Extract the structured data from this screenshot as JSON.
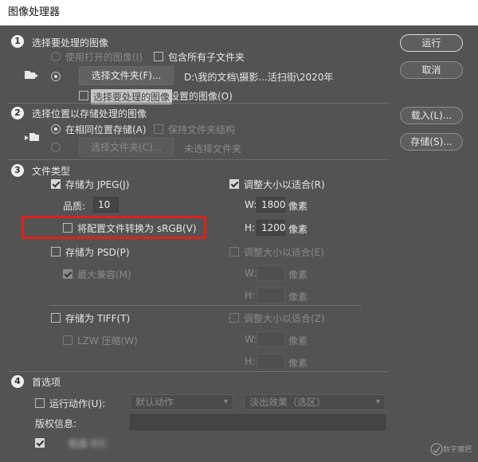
{
  "window": {
    "title": "图像处理器"
  },
  "section1": {
    "number": "1",
    "title": "选择要处理的图像",
    "use_open_label": "使用打开的图像(I)",
    "include_subfolders_label": "包含所有子文件夹",
    "select_folder_label": "选择文件夹(F)...",
    "folder_path": "D:\\我的文档\\摄影...活扫街\\2020年",
    "open_first_label": "打开第一个要应用设置的图像(O)",
    "tooltip": "选择要处理的图像"
  },
  "section2": {
    "number": "2",
    "title": "选择位置以存储处理的图像",
    "same_location_label": "在相同位置存储(A)",
    "keep_structure_label": "保持文件夹结构",
    "select_folder_label": "选择文件夹(C)...",
    "no_folder_label": "未选择文件夹"
  },
  "section3": {
    "number": "3",
    "title": "文件类型",
    "jpeg": {
      "save_label": "存储为 JPEG(J)",
      "resize_label": "调整大小以适合(R)",
      "quality_label": "品质:",
      "quality_value": "10",
      "w_label": "W:",
      "w_value": "1800",
      "h_label": "H:",
      "h_value": "1200",
      "unit": "像素",
      "srgb_label": "将配置文件转换为 sRGB(V)"
    },
    "psd": {
      "save_label": "存储为 PSD(P)",
      "resize_label": "调整大小以适合(E)",
      "max_compat_label": "最大兼容(M)",
      "w_label": "W:",
      "h_label": "H:",
      "unit": "像素"
    },
    "tiff": {
      "save_label": "存储为 TIFF(T)",
      "resize_label": "调整大小以适合(Z)",
      "lzw_label": "LZW 压缩(W)",
      "w_label": "W:",
      "h_label": "H:",
      "unit": "像素"
    }
  },
  "section4": {
    "number": "4",
    "title": "首选项",
    "run_action_label": "运行动作(U):",
    "action_set": "默认动作",
    "action_name": "淡出效果（选区）",
    "copyright_label": "版权信息:",
    "icc_label": "包含 ICC"
  },
  "buttons": {
    "run": "运行",
    "cancel": "取消",
    "load": "载入(L)...",
    "save": "存储(S)..."
  },
  "watermark": "数字魔把"
}
